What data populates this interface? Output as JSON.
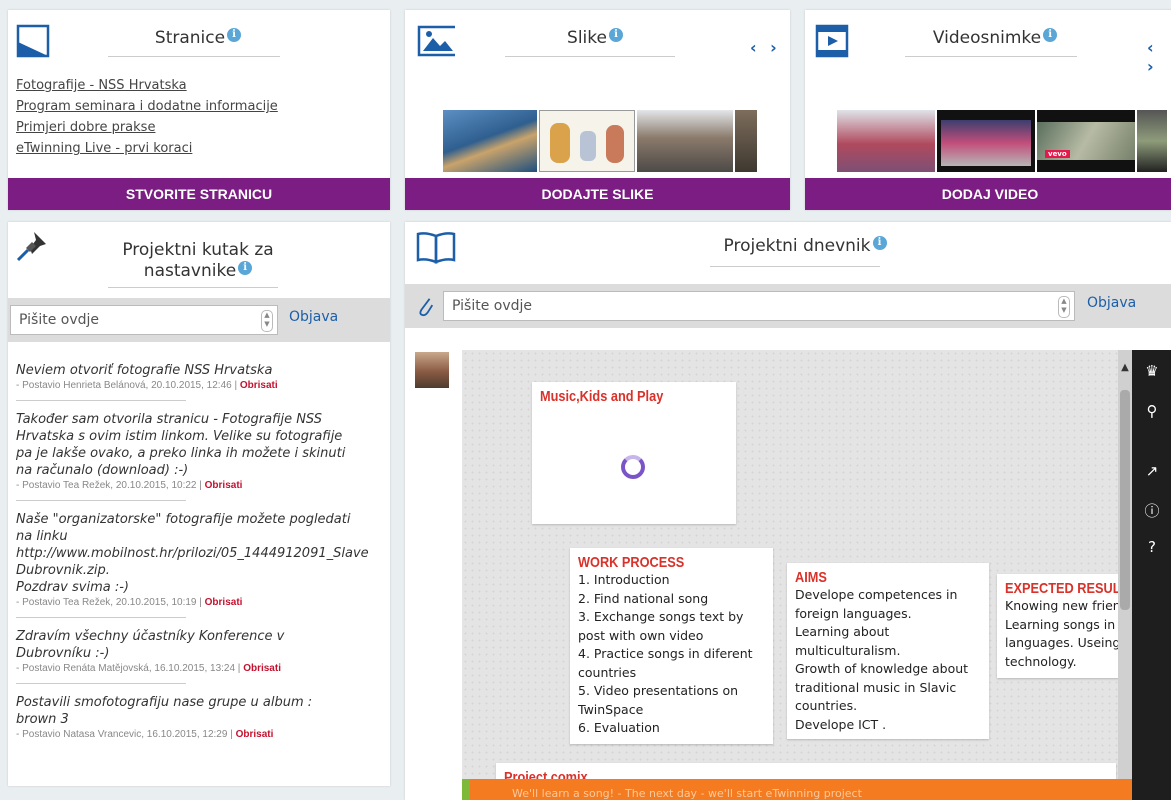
{
  "pages_card": {
    "title": "Stranice",
    "links": [
      "Fotografije - NSS Hrvatska",
      "Program seminara i dodatne informacije",
      "Primjeri dobre prakse",
      "eTwinning Live - prvi koraci"
    ],
    "button": "STVORITE STRANICU"
  },
  "images_card": {
    "title": "Slike",
    "button": "DODAJTE SLIKE",
    "arrows": "‹ ›"
  },
  "videos_card": {
    "title": "Videosnimke",
    "button": "DODAJ VIDEO",
    "arrows": "‹ ›",
    "vevo": "vevo"
  },
  "teachers_corner": {
    "title": "Projektni kutak za nastavnike",
    "input_placeholder": "Pišite ovdje",
    "post_label": "Objava",
    "delete_label": "Obrisati",
    "posts": [
      {
        "text": "Neviem otvoriť fotografie NSS Hrvatska",
        "meta": "- Postavio Henrieta Belánová, 20.10.2015, 12:46 |"
      },
      {
        "text": "Također sam otvorila stranicu - Fotografije NSS\nHrvatska s ovim istim linkom. Velike su fotografije\npa je lakše ovako, a preko linka ih možete i skinuti\nna računalo (download) :-)",
        "meta": "- Postavio Tea Režek, 20.10.2015, 10:22 |"
      },
      {
        "text": "Naše \"organizatorske\" fotografije možete pogledati\nna linku\nhttp://www.mobilnost.hr/prilozi/05_1444912091_Slave\nDubrovnik.zip.\nPozdrav svima :-)",
        "meta": "- Postavio Tea Režek, 20.10.2015, 10:19 |"
      },
      {
        "text": "Zdravím všechny účastníky Konference v\nDubrovníku :-)",
        "meta": "- Postavio Renáta Matějovská, 16.10.2015, 13:24 |"
      },
      {
        "text": "Postavili smofotografiju nase grupe u album :\nbrown 3",
        "meta": "- Postavio Natasa Vrancevic, 16.10.2015, 12:29 |"
      }
    ]
  },
  "diary": {
    "title": "Projektni dnevnik",
    "input_placeholder": "Pišite ovdje",
    "post_label": "Objava",
    "notes": {
      "music": {
        "title": "Music,Kids and Play"
      },
      "work": {
        "title": "WORK PROCESS",
        "body": "1. Introduction\n2. Find national song\n3. Exchange songs text by\npost with own video\n4. Practice songs in diferent\ncountries\n5. Video presentations on\nTwinSpace\n6. Evaluation"
      },
      "aims": {
        "title": "AIMS",
        "body": "Develope competences in\nforeign languages.\nLearning about\nmulticulturalism.\nGrowth of knowledge about\ntraditional music in Slavic\ncountries.\nDevelope ICT ."
      },
      "results": {
        "title": "EXPECTED RESULTS",
        "body": "Knowing new friends\nLearning songs in\nlanguages. Useing\ntechnology."
      },
      "comix": {
        "title": "Project comix"
      }
    },
    "ticker": "We'll learn a song! - The next day - we'll start eTwinning project"
  },
  "colors": {
    "accent_purple": "#7b1d82",
    "link_blue": "#1c5fa8",
    "delete_red": "#c4122f",
    "note_red": "#d8322a",
    "orange": "#f47b20"
  }
}
